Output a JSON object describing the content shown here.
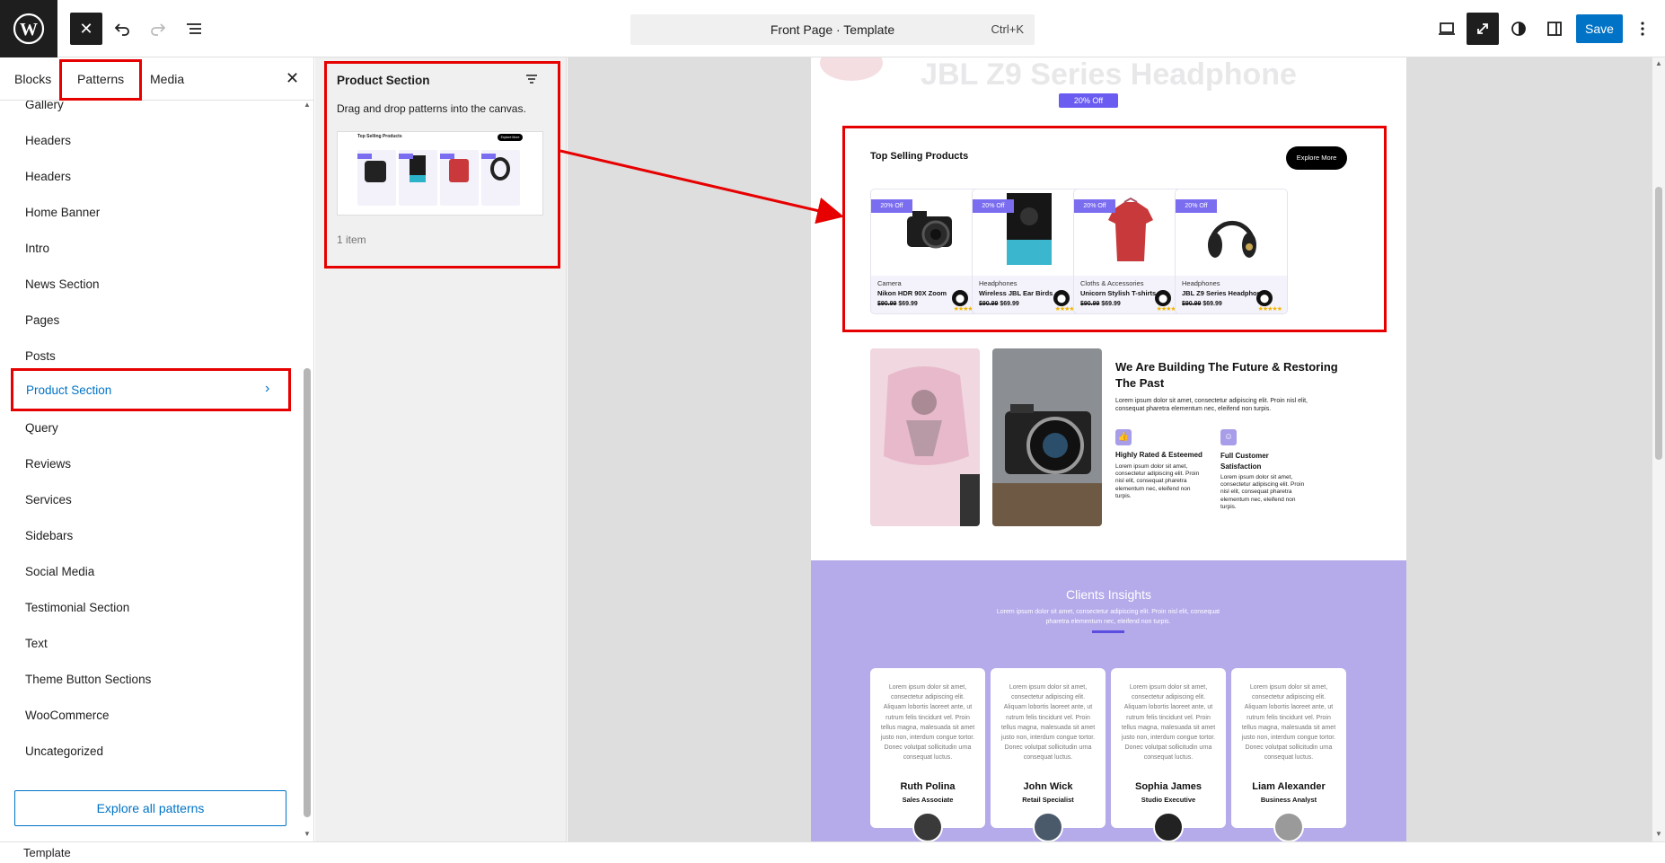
{
  "topbar": {
    "document_title": "Front Page · Template",
    "shortcut": "Ctrl+K",
    "save_label": "Save"
  },
  "inserter": {
    "tabs": [
      "Blocks",
      "Patterns",
      "Media"
    ],
    "active_tab": "Patterns",
    "categories": [
      "Gallery",
      "Headers",
      "Headers",
      "Home Banner",
      "Intro",
      "News Section",
      "Pages",
      "Posts",
      "Product Section",
      "Query",
      "Reviews",
      "Services",
      "Sidebars",
      "Social Media",
      "Testimonial Section",
      "Text",
      "Theme Button Sections",
      "WooCommerce",
      "Uncategorized"
    ],
    "selected_category": "Product Section",
    "explore_label": "Explore all patterns"
  },
  "pattern_panel": {
    "title": "Product Section",
    "hint": "Drag and drop patterns into the canvas.",
    "count": "1 item",
    "preview_title": "Top Selling Products",
    "preview_button": "Explore More"
  },
  "canvas": {
    "hero_title": "JBL Z9 Series Headphone",
    "hero_badge": "20% Off",
    "products_title": "Top Selling Products",
    "explore_button": "Explore More",
    "products": [
      {
        "badge": "20% Off",
        "category": "Camera",
        "name": "Nikon HDR 90X Zoom",
        "old_price": "$90.99",
        "price": "$69.99"
      },
      {
        "badge": "20% Off",
        "category": "Headphones",
        "name": "Wireless JBL Ear Birds",
        "old_price": "$90.99",
        "price": "$69.99"
      },
      {
        "badge": "20% Off",
        "category": "Cloths & Accessories",
        "name": "Unicorn Stylish T-shirts",
        "old_price": "$90.99",
        "price": "$69.99"
      },
      {
        "badge": "20% Off",
        "category": "Headphones",
        "name": "JBL Z9 Series Headphone",
        "old_price": "$90.99",
        "price": "$69.99"
      }
    ],
    "about": {
      "title": "We Are Building The Future & Restoring The Past",
      "text": "Lorem ipsum dolor sit amet, consectetur adipiscing elit. Proin nisl elit, consequat pharetra elementum nec, eleifend non turpis.",
      "feature1_title": "Highly Rated & Esteemed",
      "feature1_text": "Lorem ipsum dolor sit amet, consectetur adipiscing elit. Proin nisl elit, consequat pharetra elementum nec, eleifend non turpis.",
      "feature2_title": "Full Customer Satisfaction",
      "feature2_text": "Lorem ipsum dolor sit amet, consectetur adipiscing elit. Proin nisl elit, consequat pharetra elementum nec, eleifend non turpis."
    },
    "clients": {
      "title": "Clients Insights",
      "text": "Lorem ipsum dolor sit amet, consectetur adipiscing elit. Proin nisl elit, consequat pharetra elementum nec, eleifend non turpis.",
      "quote": "Lorem ipsum dolor sit amet, consectetur adipiscing elit. Aliquam lobortis laoreet ante, ut rutrum felis tincidunt vel. Proin tellus magna, malesuada sit amet justo non, interdum congue tortor. Donec volutpat sollicitudin urna consequat luctus.",
      "people": [
        {
          "name": "Ruth Polina",
          "role": "Sales Associate"
        },
        {
          "name": "John Wick",
          "role": "Retail Specialist"
        },
        {
          "name": "Sophia James",
          "role": "Studio Executive"
        },
        {
          "name": "Liam Alexander",
          "role": "Business Analyst"
        }
      ]
    }
  },
  "statusbar": {
    "breadcrumb": "Template"
  }
}
